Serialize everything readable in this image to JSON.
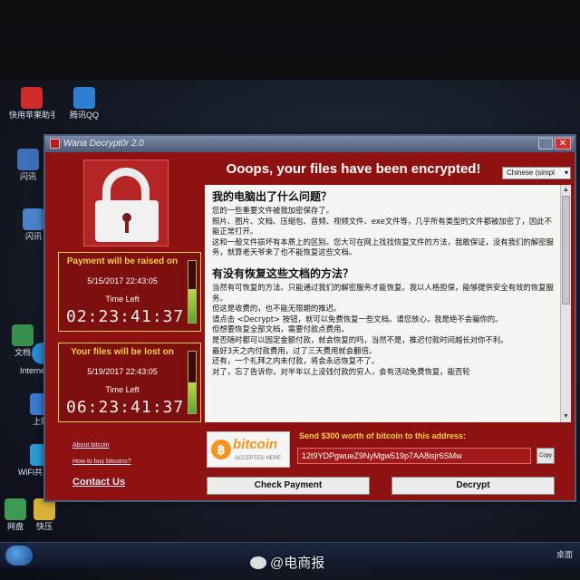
{
  "desktop": {
    "icons": [
      {
        "label": "快用苹果助手"
      },
      {
        "label": "腾讯QQ"
      },
      {
        "label": "闪讯"
      },
      {
        "label": "闪讯"
      },
      {
        "label": "文档"
      },
      {
        "label": "Internet Explorer"
      },
      {
        "label": "上网"
      },
      {
        "label": "WiFi共享精灵"
      },
      {
        "label": "快压"
      },
      {
        "label": "网盘"
      }
    ]
  },
  "window": {
    "title": "Wana Decrypt0r 2.0",
    "headline": "Ooops, your files have been encrypted!",
    "language": "Chinese (simpl",
    "panels": [
      {
        "header": "Payment will be raised on",
        "date": "5/15/2017 22:43:05",
        "time_left_label": "Time Left",
        "timer": "02:23:41:37",
        "progress": 0.55
      },
      {
        "header": "Your files will be lost on",
        "date": "5/19/2017 22:43:05",
        "time_left_label": "Time Left",
        "timer": "06:23:41:37",
        "progress": 0.5
      }
    ],
    "links": {
      "about_bitcoin": "About bitcoin",
      "how_to_buy": "How to buy bitcoins?",
      "contact_us": "Contact Us"
    },
    "message": {
      "h1": "我的电脑出了什么问题？",
      "p1": "您的一些重要文件被我加密保存了。",
      "p2": "照片、图片、文档、压缩包、音频、视频文件、exe文件等，几乎所有类型的文件都被加密了，因此不能正常打开。",
      "p3": "这和一般文件损坏有本质上的区别。您大可在网上找找恢复文件的方法，我敢保证，没有我们的解密服务，就算老天爷来了也不能恢复这些文档。",
      "h2": "有没有恢复这些文档的方法？",
      "p4": "当然有可恢复的方法。只能通过我们的解密服务才能恢复。我以人格担保，能够提供安全有效的恢复服务。",
      "p5": "但这是收费的，也不能无限期的推迟。",
      "p6": "请点击 <Decrypt> 按钮，就可以免费恢复一些文档。请您放心，我是绝不会骗你的。",
      "p7": "但想要恢复全部文档，需要付款点费用。",
      "p8": "是否随时都可以固定金额付款，就会恢复的吗，当然不是，推迟付款时间越长对你不利。",
      "p9": "最好3天之内付款费用，过了三天费用就会翻倍。",
      "p10": "还有，一个礼拜之内未付款，将会永远恢复不了。",
      "p11": "对了，忘了告诉你，对半年以上没钱付款的穷人，会有活动免费恢复，能否轮"
    },
    "bitcoin": {
      "logo_word": "bitcoin",
      "logo_sub": "ACCEPTED HERE",
      "send_label": "Send $300 worth of bitcoin to this address:",
      "address": "12t9YDPgwueZ9NyMgw519p7AA8isjr6SMw",
      "copy_label": "Copy"
    },
    "buttons": {
      "check_payment": "Check Payment",
      "decrypt": "Decrypt"
    }
  },
  "taskbar": {
    "tray_text": "桌面"
  },
  "watermark": "@电商报"
}
